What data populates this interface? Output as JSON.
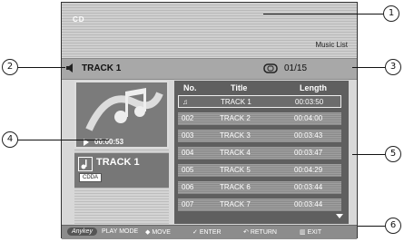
{
  "header": {
    "logo": "CD",
    "screen_title": "Music List"
  },
  "now_playing": {
    "track": "TRACK 1",
    "counter": "01/15",
    "elapsed": "00:00:53",
    "disc_type": "CDDA"
  },
  "list": {
    "columns": {
      "no": "No.",
      "title": "Title",
      "length": "Length"
    },
    "rows": [
      {
        "no": "",
        "title": "TRACK 1",
        "length": "00:03:50",
        "selected": true
      },
      {
        "no": "002",
        "title": "TRACK 2",
        "length": "00:04:00"
      },
      {
        "no": "003",
        "title": "TRACK 3",
        "length": "00:03:43"
      },
      {
        "no": "004",
        "title": "TRACK 4",
        "length": "00:03:47"
      },
      {
        "no": "005",
        "title": "TRACK 5",
        "length": "00:04:29"
      },
      {
        "no": "006",
        "title": "TRACK 6",
        "length": "00:03:44"
      },
      {
        "no": "007",
        "title": "TRACK 7",
        "length": "00:03:44"
      }
    ]
  },
  "footer": {
    "anykey": "Anykey",
    "play_mode": "PLAY MODE",
    "move": "MOVE",
    "enter": "ENTER",
    "return": "RETURN",
    "exit": "EXIT"
  },
  "callouts": [
    "1",
    "2",
    "3",
    "4",
    "5",
    "6"
  ]
}
